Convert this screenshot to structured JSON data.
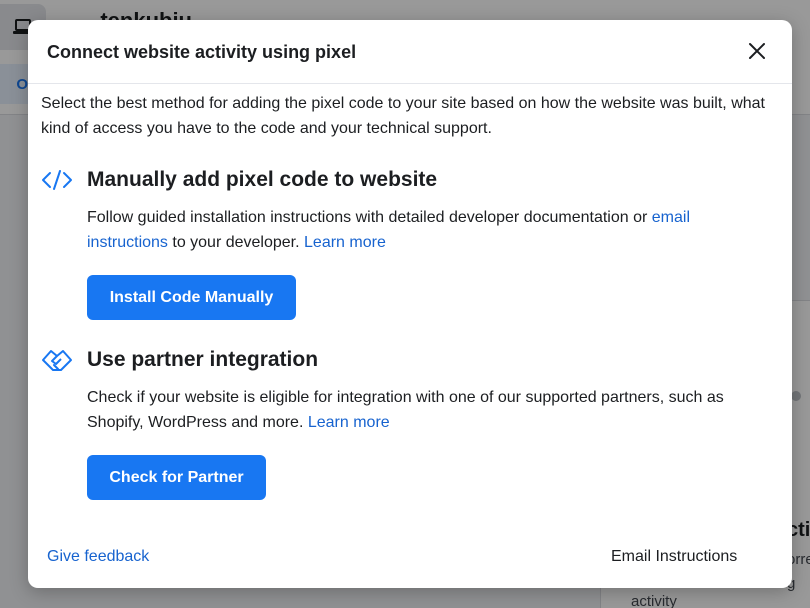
{
  "background": {
    "title": "...tenkubiu",
    "tab_label": "O",
    "card_title": "cti",
    "card_line1": "orre",
    "card_line2": "g",
    "card_line3": "activity"
  },
  "modal": {
    "title": "Connect website activity using pixel",
    "intro": "Select the best method for adding the pixel code to your site based on how the website was built, what kind of access you have to the code and your technical support.",
    "manual": {
      "icon": "code-icon",
      "title": "Manually add pixel code to website",
      "desc_part1": "Follow guided installation instructions with detailed developer documentation or ",
      "email_link": "email instructions",
      "desc_part2": " to your developer. ",
      "learn_more": "Learn more",
      "button_label": "Install Code Manually"
    },
    "partner": {
      "icon": "handshake-icon",
      "title": "Use partner integration",
      "desc_part1": "Check if your website is eligible for integration with one of our supported partners, such as Shopify, WordPress and more. ",
      "learn_more": "Learn more",
      "button_label": "Check for Partner"
    },
    "footer": {
      "feedback_label": "Give feedback",
      "email_instructions_label": "Email Instructions"
    }
  },
  "colors": {
    "primary": "#1877f2",
    "link": "#1763cf",
    "text": "#1c1e21",
    "overlay": "rgba(0,0,0,0.40)"
  }
}
